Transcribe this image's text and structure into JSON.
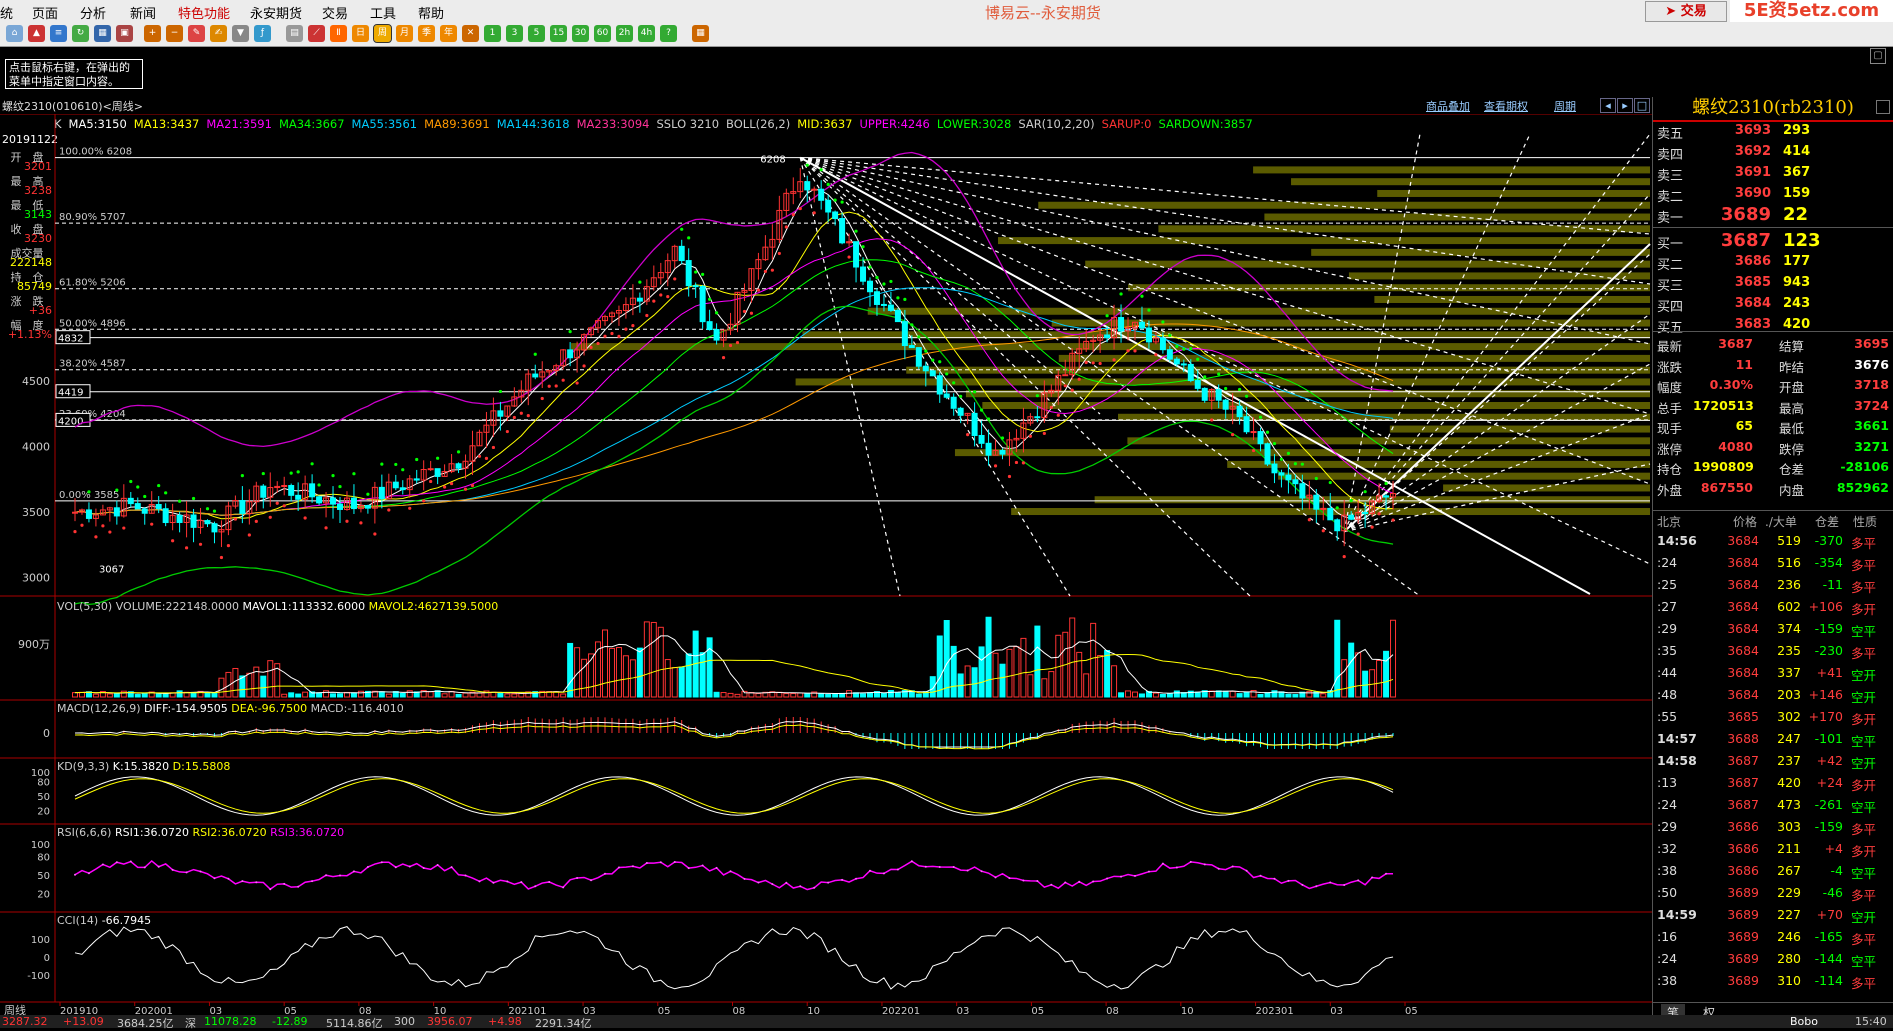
{
  "menu": {
    "items": [
      "统",
      "页面",
      "分析",
      "新闻",
      "特色功能",
      "永安期货",
      "交易",
      "工具",
      "帮助"
    ],
    "app_title": "博易云--永安期货",
    "trade_button": "交易",
    "watermark": "5E资5etz.com"
  },
  "tooltip": {
    "line1": "点击鼠标右键，在弹出的",
    "line2": "菜单中指定窗口内容。"
  },
  "chart_header": {
    "symbol": "螺纹2310(010610)<周线>",
    "links": [
      "商品叠加",
      "查看期权",
      "周期"
    ]
  },
  "indicators": {
    "k_label": "K",
    "ma": [
      {
        "text": "MA5:3150",
        "color": "#ffffff"
      },
      {
        "text": "MA13:3437",
        "color": "#ffff00"
      },
      {
        "text": "MA21:3591",
        "color": "#ff00ff"
      },
      {
        "text": "MA34:3667",
        "color": "#00ff00"
      },
      {
        "text": "MA55:3561",
        "color": "#00ccff"
      },
      {
        "text": "MA89:3691",
        "color": "#ff9900"
      },
      {
        "text": "MA144:3618",
        "color": "#00ccff"
      },
      {
        "text": "MA233:3094",
        "color": "#ff3399"
      },
      {
        "text": "SSLO 3210",
        "color": "#cccccc"
      },
      {
        "text": "BOLL(26,2)",
        "color": "#cccccc"
      },
      {
        "text": "MID:3637",
        "color": "#ffff00"
      },
      {
        "text": "UPPER:4246",
        "color": "#ff00ff"
      },
      {
        "text": "LOWER:3028",
        "color": "#00ff00"
      },
      {
        "text": "SAR(10,2,20)",
        "color": "#cccccc"
      },
      {
        "text": "SARUP:0",
        "color": "#ff3333"
      },
      {
        "text": "SARDOWN:3857",
        "color": "#00ff00"
      }
    ]
  },
  "info_column": {
    "date": "20191122",
    "fields": [
      {
        "label": "开　盘",
        "value": "3201",
        "color": "#ff3333"
      },
      {
        "label": "最　高",
        "value": "3238",
        "color": "#ff3333"
      },
      {
        "label": "最　低",
        "value": "3143",
        "color": "#00ff00"
      },
      {
        "label": "收　盘",
        "value": "3230",
        "color": "#ff3333"
      },
      {
        "label": "成交量",
        "value": "222148",
        "color": "#ffff00"
      },
      {
        "label": "持　仓",
        "value": "85749",
        "color": "#ffff00"
      },
      {
        "label": "涨　跌",
        "value": "+36",
        "color": "#ff3333"
      },
      {
        "label": "幅　度",
        "value": "+1.13%",
        "color": "#ff3333"
      }
    ]
  },
  "main_chart": {
    "y_ticks": [
      "4500",
      "4000",
      "3500",
      "3000"
    ],
    "fib_levels": [
      {
        "label": "100.00% 6208"
      },
      {
        "label": "80.90% 5707"
      },
      {
        "label": "61.80% 5206"
      },
      {
        "label": "50.00% 4896"
      },
      {
        "label": "38.20% 4587"
      },
      {
        "label": "23.60% 4204"
      },
      {
        "label": "0.00% 3585"
      }
    ],
    "price_tags": [
      "4832",
      "4419",
      "4200"
    ],
    "peak_label": "6208",
    "low_label": "3067"
  },
  "volume_panel": {
    "title_prefix": "VOL(5,30)",
    "volume": "VOLUME:222148.0000",
    "mavol1": "MAVOL1:113332.6000",
    "mavol2": "MAVOL2:4627139.5000",
    "y_tick": "900万"
  },
  "macd_panel": {
    "title": "MACD(12,26,9)",
    "diff": "DIFF:-154.9505",
    "dea": "DEA:-96.7500",
    "macd": "MACD:-116.4010",
    "y_tick": "0"
  },
  "kd_panel": {
    "title": "KD(9,3,3)",
    "k": "K:15.3820",
    "d": "D:15.5808",
    "y_ticks": [
      "100",
      "80",
      "50",
      "20"
    ]
  },
  "rsi_panel": {
    "title": "RSI(6,6,6)",
    "rsi1": "RSI1:36.0720",
    "rsi2": "RSI2:36.0720",
    "rsi3": "RSI3:36.0720",
    "y_ticks": [
      "100",
      "80",
      "50",
      "20"
    ]
  },
  "cci_panel": {
    "title": "CCI(14)",
    "value": "-66.7945",
    "y_ticks": [
      "100",
      "0",
      "-100"
    ]
  },
  "x_axis": {
    "label": "周线",
    "ticks": [
      "201910",
      "202001",
      "03",
      "05",
      "08",
      "10",
      "202101",
      "03",
      "05",
      "08",
      "10",
      "202201",
      "03",
      "05",
      "08",
      "10",
      "202301",
      "03",
      "05"
    ]
  },
  "right_panel": {
    "title": "螺纹2310(rb2310)",
    "asks": [
      {
        "label": "卖五",
        "price": "3693",
        "vol": "293"
      },
      {
        "label": "卖四",
        "price": "3692",
        "vol": "414"
      },
      {
        "label": "卖三",
        "price": "3691",
        "vol": "367"
      },
      {
        "label": "卖二",
        "price": "3690",
        "vol": "159"
      },
      {
        "label": "卖一",
        "price": "3689",
        "vol": "22"
      }
    ],
    "bids": [
      {
        "label": "买一",
        "price": "3687",
        "vol": "123"
      },
      {
        "label": "买二",
        "price": "3686",
        "vol": "177"
      },
      {
        "label": "买三",
        "price": "3685",
        "vol": "943"
      },
      {
        "label": "买四",
        "price": "3684",
        "vol": "243"
      },
      {
        "label": "买五",
        "price": "3683",
        "vol": "420"
      }
    ],
    "quotes": [
      {
        "l1": "最新",
        "v1": "3687",
        "c1": "#ff3d3d",
        "l2": "结算",
        "v2": "3695",
        "c2": "#ff3d3d"
      },
      {
        "l1": "涨跌",
        "v1": "11",
        "c1": "#ff3d3d",
        "l2": "昨结",
        "v2": "3676",
        "c2": "#ffffff"
      },
      {
        "l1": "幅度",
        "v1": "0.30%",
        "c1": "#ff3d3d",
        "l2": "开盘",
        "v2": "3718",
        "c2": "#ff3d3d"
      },
      {
        "l1": "总手",
        "v1": "1720513",
        "c1": "#ffff00",
        "l2": "最高",
        "v2": "3724",
        "c2": "#ff3d3d"
      },
      {
        "l1": "现手",
        "v1": "65",
        "c1": "#ffff00",
        "l2": "最低",
        "v2": "3661",
        "c2": "#00ff00"
      },
      {
        "l1": "涨停",
        "v1": "4080",
        "c1": "#ff3d3d",
        "l2": "跌停",
        "v2": "3271",
        "c2": "#00ff00"
      },
      {
        "l1": "持仓",
        "v1": "1990809",
        "c1": "#ffff00",
        "l2": "仓差",
        "v2": "-28106",
        "c2": "#00ff00"
      },
      {
        "l1": "外盘",
        "v1": "867550",
        "c1": "#ff3d3d",
        "l2": "内盘",
        "v2": "852962",
        "c2": "#00ff00"
      }
    ],
    "tick_header": {
      "time": "北京",
      "price": "价格",
      "vol": "./大单",
      "oi": "仓差",
      "nat": "性质"
    },
    "ticks": [
      {
        "time": "14:56",
        "price": "3684",
        "vol": "519",
        "oi": "-370",
        "nat": "多平",
        "natc": "#ff3d3d",
        "oic": "#00ff00"
      },
      {
        "time": ":24",
        "price": "3684",
        "vol": "516",
        "oi": "-354",
        "nat": "多平",
        "natc": "#ff3d3d",
        "oic": "#00ff00"
      },
      {
        "time": ":25",
        "price": "3684",
        "vol": "236",
        "oi": "-11",
        "nat": "多平",
        "natc": "#ff3d3d",
        "oic": "#00ff00"
      },
      {
        "time": ":27",
        "price": "3684",
        "vol": "602",
        "oi": "+106",
        "nat": "多开",
        "natc": "#ff3d3d",
        "oic": "#ff3d3d"
      },
      {
        "time": ":29",
        "price": "3684",
        "vol": "374",
        "oi": "-159",
        "nat": "空平",
        "natc": "#00ff00",
        "oic": "#00ff00"
      },
      {
        "time": ":35",
        "price": "3684",
        "vol": "235",
        "oi": "-230",
        "nat": "多平",
        "natc": "#ff3d3d",
        "oic": "#00ff00"
      },
      {
        "time": ":44",
        "price": "3684",
        "vol": "337",
        "oi": "+41",
        "nat": "空开",
        "natc": "#00ff00",
        "oic": "#ff3d3d"
      },
      {
        "time": ":48",
        "price": "3684",
        "vol": "203",
        "oi": "+146",
        "nat": "空开",
        "natc": "#00ff00",
        "oic": "#ff3d3d"
      },
      {
        "time": ":55",
        "price": "3685",
        "vol": "302",
        "oi": "+170",
        "nat": "多开",
        "natc": "#ff3d3d",
        "oic": "#ff3d3d"
      },
      {
        "time": "14:57",
        "price": "3688",
        "vol": "247",
        "oi": "-101",
        "nat": "空平",
        "natc": "#00ff00",
        "oic": "#00ff00"
      },
      {
        "time": "14:58",
        "price": "3687",
        "vol": "237",
        "oi": "+42",
        "nat": "空开",
        "natc": "#00ff00",
        "oic": "#ff3d3d"
      },
      {
        "time": ":13",
        "price": "3687",
        "vol": "420",
        "oi": "+24",
        "nat": "多开",
        "natc": "#ff3d3d",
        "oic": "#ff3d3d"
      },
      {
        "time": ":24",
        "price": "3687",
        "vol": "473",
        "oi": "-261",
        "nat": "空平",
        "natc": "#00ff00",
        "oic": "#00ff00"
      },
      {
        "time": ":29",
        "price": "3686",
        "vol": "303",
        "oi": "-159",
        "nat": "多平",
        "natc": "#ff3d3d",
        "oic": "#00ff00"
      },
      {
        "time": ":32",
        "price": "3686",
        "vol": "211",
        "oi": "+4",
        "nat": "多开",
        "natc": "#ff3d3d",
        "oic": "#ff3d3d"
      },
      {
        "time": ":38",
        "price": "3686",
        "vol": "267",
        "oi": "-4",
        "nat": "空平",
        "natc": "#00ff00",
        "oic": "#00ff00"
      },
      {
        "time": ":50",
        "price": "3689",
        "vol": "229",
        "oi": "-46",
        "nat": "多平",
        "natc": "#ff3d3d",
        "oic": "#00ff00"
      },
      {
        "time": "14:59",
        "price": "3689",
        "vol": "227",
        "oi": "+70",
        "nat": "空开",
        "natc": "#00ff00",
        "oic": "#ff3d3d"
      },
      {
        "time": ":16",
        "price": "3689",
        "vol": "246",
        "oi": "-165",
        "nat": "多平",
        "natc": "#ff3d3d",
        "oic": "#00ff00"
      },
      {
        "time": ":24",
        "price": "3689",
        "vol": "280",
        "oi": "-144",
        "nat": "空平",
        "natc": "#00ff00",
        "oic": "#00ff00"
      },
      {
        "time": ":38",
        "price": "3689",
        "vol": "310",
        "oi": "-114",
        "nat": "多平",
        "natc": "#ff3d3d",
        "oic": "#00ff00"
      }
    ],
    "bottom_tabs": [
      "笔",
      "权"
    ]
  },
  "bottom_bar": {
    "items": [
      {
        "text": "3287.32",
        "color": "#ff3333"
      },
      {
        "text": "+13.09",
        "color": "#ff3333"
      },
      {
        "text": "3684.25亿",
        "color": "#cccccc"
      },
      {
        "text": "深",
        "color": "#cccccc"
      },
      {
        "text": "11078.28",
        "color": "#00ff00"
      },
      {
        "text": "-12.89",
        "color": "#00ff00"
      },
      {
        "text": "5114.86亿",
        "color": "#cccccc"
      },
      {
        "text": "300",
        "color": "#cccccc"
      },
      {
        "text": "3956.07",
        "color": "#ff3333"
      },
      {
        "text": "+4.98",
        "color": "#ff3333"
      },
      {
        "text": "2291.34亿",
        "color": "#cccccc"
      }
    ],
    "right": "Bobo",
    "clock": "15:40"
  }
}
